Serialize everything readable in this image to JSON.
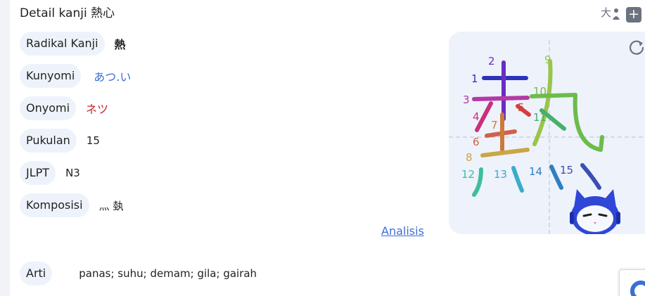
{
  "title": "Detail kanji 熱心",
  "rows": {
    "radikal": {
      "label": "Radikal Kanji",
      "value": "熱"
    },
    "kunyomi": {
      "label": "Kunyomi",
      "value": "あつ.い"
    },
    "onyomi": {
      "label": "Onyomi",
      "value": "ネツ"
    },
    "pukulan": {
      "label": "Pukulan",
      "value": "15"
    },
    "jlpt": {
      "label": "JLPT",
      "value": "N3"
    },
    "komposisi": {
      "label": "Komposisi",
      "value": "灬 埶"
    },
    "arti": {
      "label": "Arti",
      "value": "panas; suhu; demam; gila; gairah"
    }
  },
  "analysis_link": "Analisis",
  "toolbar": {
    "size_icon": "大",
    "add_label": "+"
  },
  "stroke_order": {
    "kanji": "熱",
    "numbers": [
      "1",
      "2",
      "3",
      "4",
      "5",
      "6",
      "7",
      "8",
      "9",
      "10",
      "11",
      "12",
      "13",
      "14",
      "15"
    ]
  },
  "icons": {
    "refresh": "refresh-icon",
    "mascot": "robot-cat-mascot-icon",
    "font_size": "font-size-icon",
    "add": "plus-icon"
  }
}
